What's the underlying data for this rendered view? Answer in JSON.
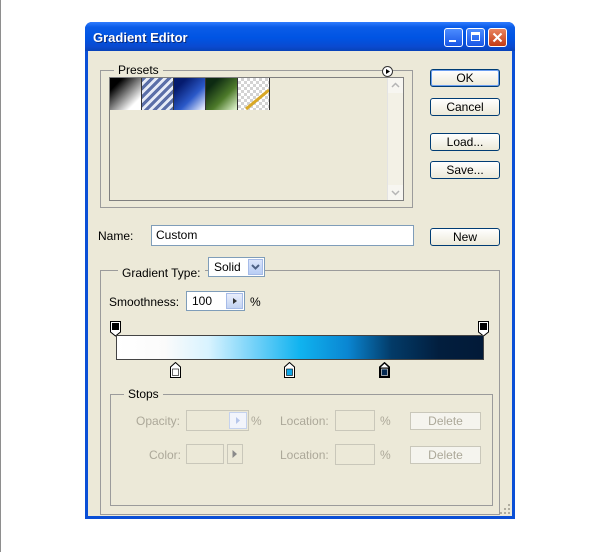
{
  "window": {
    "title": "Gradient Editor"
  },
  "presets": {
    "label": "Presets",
    "swatches": [
      {
        "name": "black-white"
      },
      {
        "name": "striped"
      },
      {
        "name": "blue"
      },
      {
        "name": "green"
      },
      {
        "name": "transparent"
      }
    ]
  },
  "buttons": {
    "ok": "OK",
    "cancel": "Cancel",
    "load": "Load...",
    "save": "Save...",
    "new": "New"
  },
  "name_field": {
    "label": "Name:",
    "value": "Custom"
  },
  "gradient": {
    "type_label": "Gradient Type:",
    "type_value": "Solid",
    "smoothness_label": "Smoothness:",
    "smoothness_value": "100",
    "smoothness_unit": "%",
    "colors": [
      "#ffffff",
      "#fbfbfb",
      "#d8f3ff",
      "#6fd0f8",
      "#10b3ef",
      "#0a86d2",
      "#033b68",
      "#021e3e",
      "#021a38"
    ]
  },
  "stops": {
    "label": "Stops",
    "opacity_label": "Opacity:",
    "opacity_unit": "%",
    "location_label_1": "Location:",
    "location_unit_1": "%",
    "delete_label_1": "Delete",
    "color_label": "Color:",
    "location_label_2": "Location:",
    "location_unit_2": "%",
    "delete_label_2": "Delete"
  }
}
